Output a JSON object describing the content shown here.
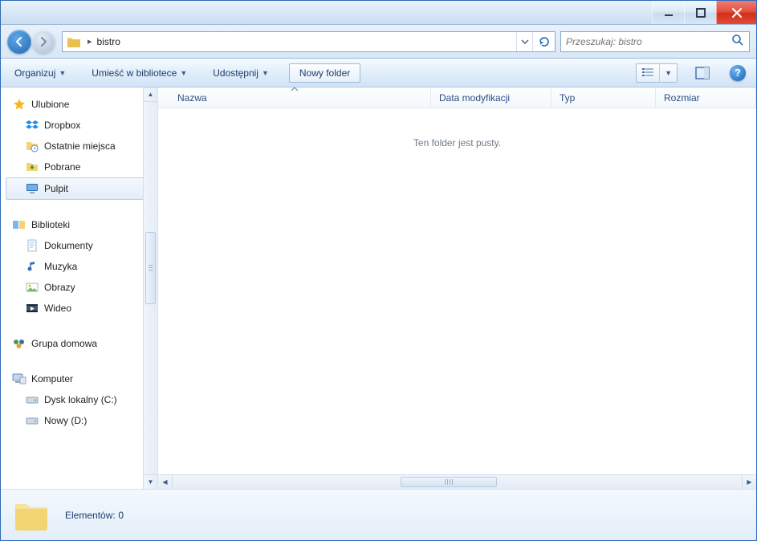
{
  "titlebar": {},
  "address": {
    "folder_name": "bistro",
    "separator": "▸"
  },
  "nav": {
    "refresh_tooltip": "Odśwież"
  },
  "search": {
    "placeholder": "Przeszukaj: bistro"
  },
  "toolbar": {
    "organize": "Organizuj",
    "include_in_library": "Umieść w bibliotece",
    "share": "Udostępnij",
    "new_folder": "Nowy folder"
  },
  "sidebar": {
    "favorites": {
      "label": "Ulubione",
      "items": [
        {
          "label": "Dropbox",
          "icon": "dropbox"
        },
        {
          "label": "Ostatnie miejsca",
          "icon": "recent"
        },
        {
          "label": "Pobrane",
          "icon": "downloads"
        },
        {
          "label": "Pulpit",
          "icon": "desktop",
          "selected": true
        }
      ]
    },
    "libraries": {
      "label": "Biblioteki",
      "items": [
        {
          "label": "Dokumenty",
          "icon": "documents"
        },
        {
          "label": "Muzyka",
          "icon": "music"
        },
        {
          "label": "Obrazy",
          "icon": "pictures"
        },
        {
          "label": "Wideo",
          "icon": "videos"
        }
      ]
    },
    "homegroup": {
      "label": "Grupa domowa"
    },
    "computer": {
      "label": "Komputer",
      "items": [
        {
          "label": "Dysk lokalny (C:)",
          "icon": "drive"
        },
        {
          "label": "Nowy (D:)",
          "icon": "drive"
        }
      ]
    }
  },
  "columns": {
    "name": "Nazwa",
    "date": "Data modyfikacji",
    "type": "Typ",
    "size": "Rozmiar"
  },
  "main": {
    "empty_message": "Ten folder jest pusty."
  },
  "status": {
    "items_label": "Elementów:",
    "items_count": "0"
  }
}
